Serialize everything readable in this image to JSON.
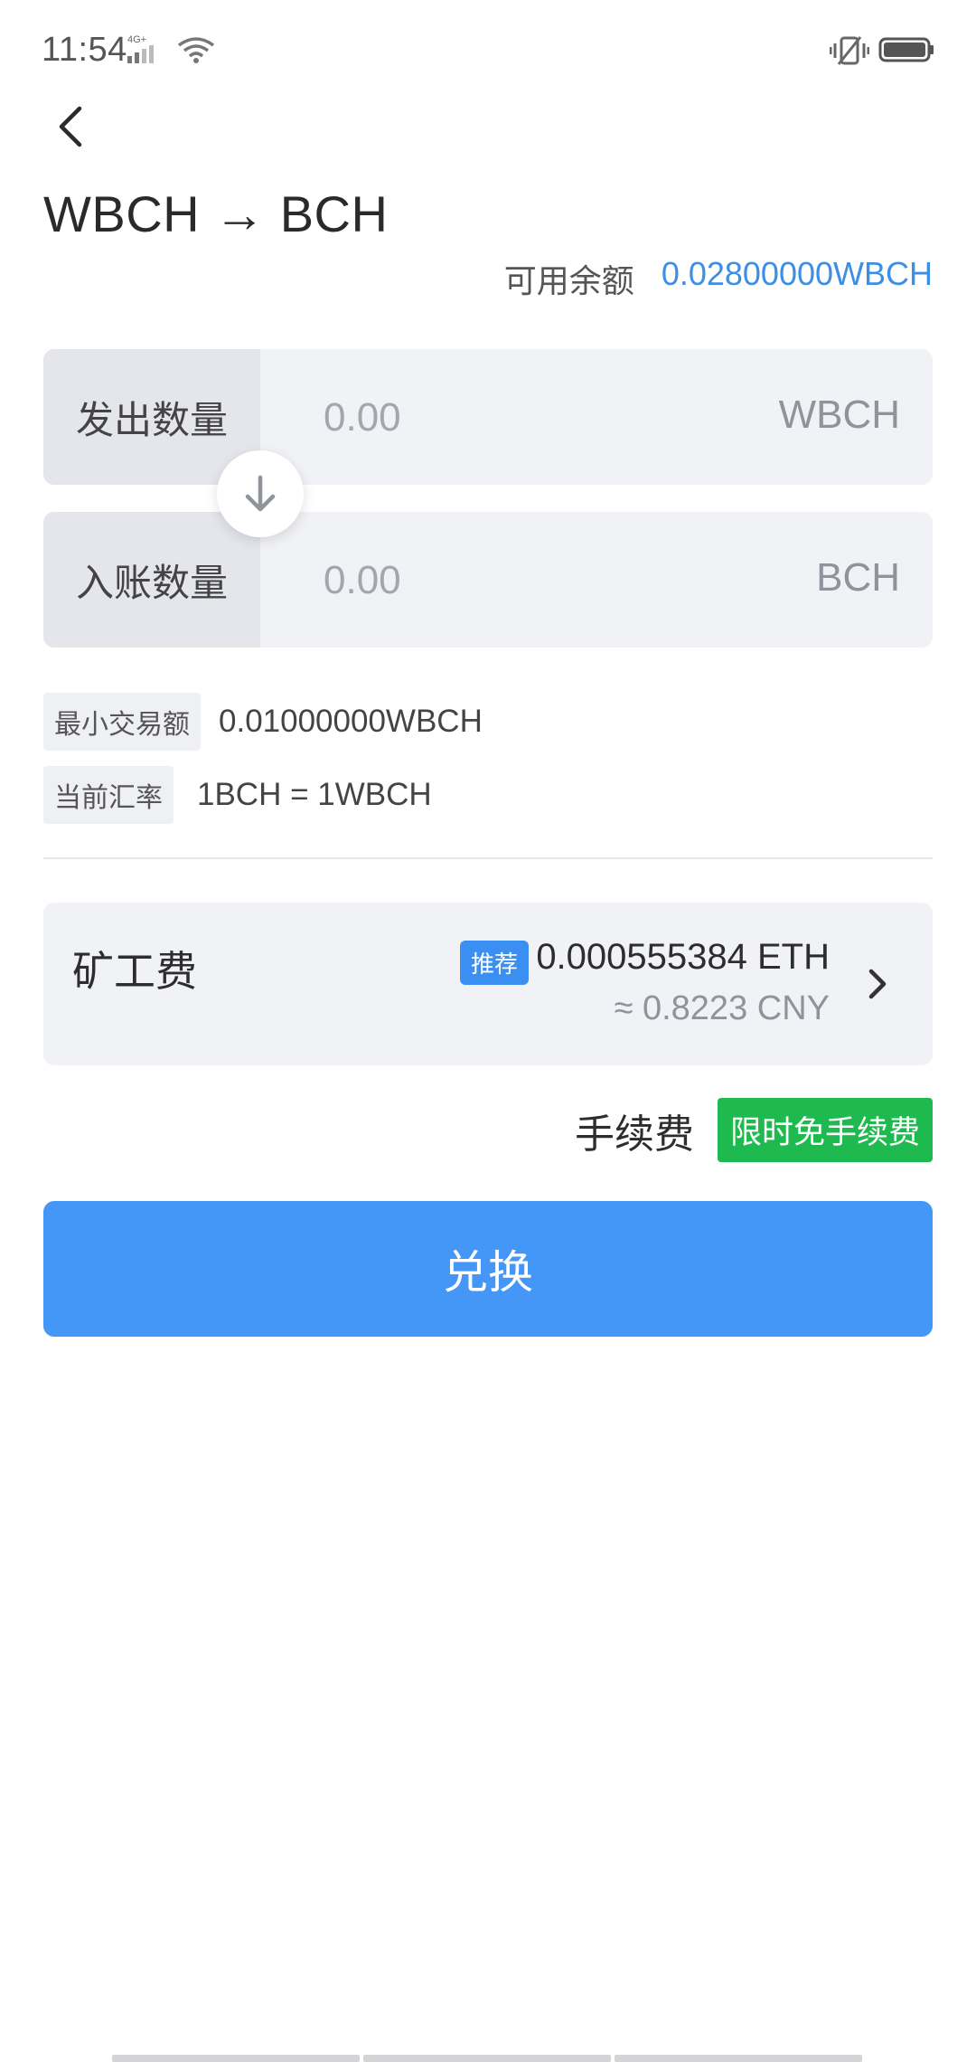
{
  "status_bar": {
    "time": "11:54",
    "network": "4G+"
  },
  "header": {
    "title": "WBCH → BCH"
  },
  "balance": {
    "label": "可用余额",
    "value": "0.02800000WBCH"
  },
  "send": {
    "label": "发出数量",
    "placeholder": "0.00",
    "unit": "WBCH"
  },
  "receive": {
    "label": "入账数量",
    "placeholder": "0.00",
    "unit": "BCH"
  },
  "min_trade": {
    "label": "最小交易额",
    "value": "0.01000000WBCH"
  },
  "rate": {
    "label": "当前汇率",
    "value": "1BCH = 1WBCH"
  },
  "miner_fee": {
    "label": "矿工费",
    "badge": "推荐",
    "eth": "0.000555384 ETH",
    "cny": "≈ 0.8223 CNY"
  },
  "service_fee": {
    "label": "手续费",
    "badge": "限时免手续费"
  },
  "exchange_button": {
    "label": "兑换"
  },
  "colors": {
    "accent": "#4597f7",
    "balance": "#3d8fe6",
    "promo": "#1fba4f"
  }
}
